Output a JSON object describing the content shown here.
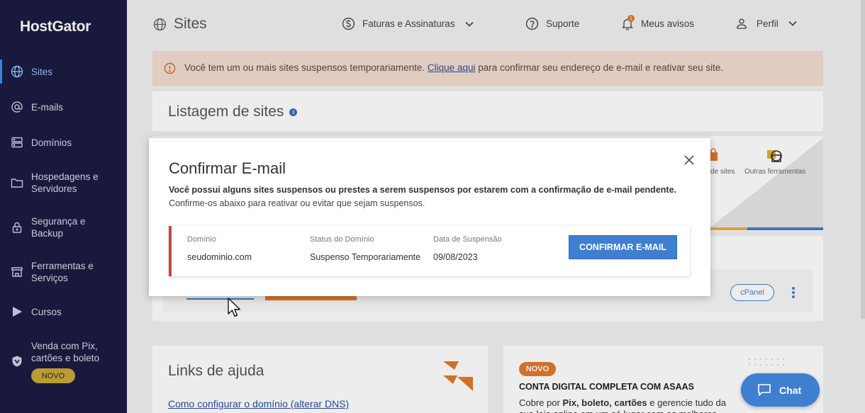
{
  "sidebar": {
    "logo": "HostGator",
    "items": [
      {
        "label": "Sites",
        "icon": "globe-icon",
        "active": true
      },
      {
        "label": "E-mails",
        "icon": "at-icon"
      },
      {
        "label": "Domínios",
        "icon": "server-icon"
      },
      {
        "label": "Hospedagens e Servidores",
        "icon": "folder-icon"
      },
      {
        "label": "Segurança e Backup",
        "icon": "lock-icon"
      },
      {
        "label": "Ferramentas e Serviços",
        "icon": "store-icon"
      },
      {
        "label": "Cursos",
        "icon": "play-icon"
      },
      {
        "label": "Venda com Pix, cartões e boleto",
        "icon": "shield-icon"
      }
    ],
    "novo_badge": "NOVO"
  },
  "header": {
    "title": "Sites",
    "billing": "Faturas e Assinaturas",
    "support": "Suporte",
    "notices": "Meus avisos",
    "notices_count": "1",
    "profile": "Perfil"
  },
  "alert": {
    "before": "Você tem um ou mais sites suspensos temporariamente.",
    "link": "Clique aqui",
    "after": "para confirmar seu endereço de e-mail e reativar seu site."
  },
  "listagem": {
    "title": "Listagem de sites",
    "tool_partial": "de sites",
    "tool_other": "Outras ferramentas",
    "cpanel": "cPanel"
  },
  "links": {
    "title": "Links de ajuda",
    "item1": "Como configurar o domínio (alterar DNS)"
  },
  "promo": {
    "tag": "NOVO",
    "title": "CONTA DIGITAL COMPLETA COM ASAAS",
    "desc_prefix": "Cobre por",
    "desc_bold": "Pix, boleto, cartões",
    "desc_suffix": "e gerencie tudo da sua loja online em um só lugar com as melhores"
  },
  "modal": {
    "title": "Confirmar E-mail",
    "bold_text": "Você possui alguns sites suspensos ou prestes a serem suspensos por estarem com a confirmação de e-mail pendente.",
    "sub_text": "Confirme-os abaixo para reativar ou evitar que sejam suspensos.",
    "card": {
      "domain_label": "Domínio",
      "domain_value": "seudominio.com",
      "status_label": "Status do Domínio",
      "status_value": "Suspenso Temporariamente",
      "date_label": "Data de Suspensão",
      "date_value": "09/08/2023",
      "button": "CONFIRMAR E-MAIL"
    }
  },
  "chat": {
    "label": "Chat"
  },
  "colors": {
    "sidebar": "#1b1b42",
    "accent": "#3f7fcf",
    "alert_bg": "#f2dccf",
    "danger": "#c94444",
    "promo": "#e07a2e"
  }
}
